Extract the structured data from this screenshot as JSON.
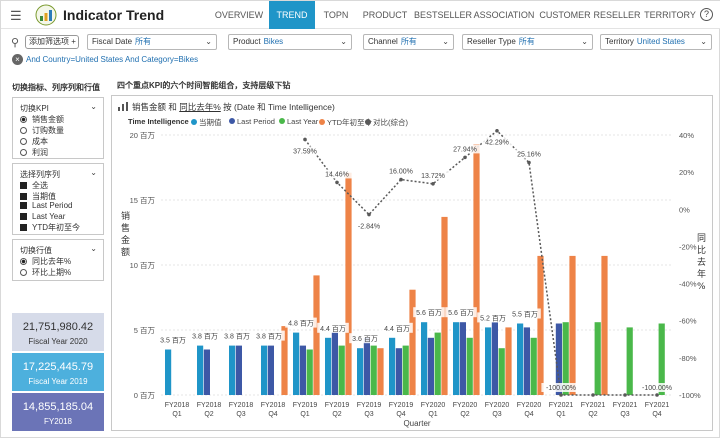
{
  "app": {
    "title": "Indicator Trend",
    "menu_icon": "hamburger-icon",
    "logo_icon": "sales-logo-icon",
    "help_icon": "help-icon",
    "help_glyph": "?",
    "tabs": [
      {
        "label": "OVERVIEW",
        "active": false
      },
      {
        "label": "TREND",
        "active": true
      },
      {
        "label": "TOPN",
        "active": false
      },
      {
        "label": "PRODUCT",
        "active": false
      },
      {
        "label": "BESTSELLER",
        "active": false
      },
      {
        "label": "ASSOCIATION",
        "active": false
      },
      {
        "label": "CUSTOMER",
        "active": false
      },
      {
        "label": "RESELLER",
        "active": false
      },
      {
        "label": "TERRITORY",
        "active": false
      }
    ]
  },
  "filters": {
    "add_filter_label": "添加筛选项 +",
    "slicers": [
      {
        "label": "Fiscal Date",
        "value": "所有"
      },
      {
        "label": "Product",
        "value": "Bikes"
      },
      {
        "label": "Channel",
        "value": "所有"
      },
      {
        "label": "Reseller Type",
        "value": "所有"
      },
      {
        "label": "Territory",
        "value": "United States"
      }
    ],
    "breadcrumb": "And Country=United States And Category=Bikes"
  },
  "left": {
    "heading": "切换指标、列序列和行值",
    "kpi_panel": {
      "title": "切换KPI",
      "options": [
        {
          "label": "销售金额",
          "selected": true
        },
        {
          "label": "订购数量",
          "selected": false
        },
        {
          "label": "成本",
          "selected": false
        },
        {
          "label": "利润",
          "selected": false
        }
      ]
    },
    "series_panel": {
      "title": "选择列序列",
      "options": [
        "全选",
        "当期值",
        "Last Period",
        "Last Year",
        "YTD年初至今"
      ]
    },
    "row_panel": {
      "title": "切换行值",
      "options": [
        {
          "label": "同比去年%",
          "selected": true
        },
        {
          "label": "环比上期%",
          "selected": false
        }
      ]
    },
    "cards": [
      {
        "value": "21,751,980.42",
        "caption": "Fiscal Year 2020",
        "bg": "#d6dbe9",
        "fg": "#333333"
      },
      {
        "value": "17,225,445.79",
        "caption": "Fiscal Year 2019",
        "bg": "#4db0dd",
        "fg": "#ffffff"
      },
      {
        "value": "14,855,185.04",
        "caption": "FY2018",
        "bg": "#6b74b7",
        "fg": "#ffffff"
      }
    ]
  },
  "chart": {
    "heading": "四个重点KPI的六个时间智能组合，支持层级下钻",
    "title_prefix": "销售金额 和 ",
    "title_link": "同比去年%",
    "title_suffix": " 按 (Date 和 Time Intelligence)",
    "legend_title": "Time Intelligence",
    "legend": [
      {
        "name": "当期值",
        "color": "#1f95c8"
      },
      {
        "name": "Last Period",
        "color": "#3d58a6"
      },
      {
        "name": "Last Year",
        "color": "#4ab84a"
      },
      {
        "name": "YTD年初至今",
        "color": "#ee8347"
      },
      {
        "name": "对比(综合)",
        "color": "#595959"
      }
    ]
  },
  "chart_data": {
    "type": "bar",
    "xlabel": "Quarter",
    "ylabel": "销售金额",
    "y2label": "同比去年%",
    "ylim": [
      0,
      20
    ],
    "y_ticks": [
      "0 百万",
      "5 百万",
      "10 百万",
      "15 百万",
      "20 百万"
    ],
    "y2lim": [
      -100,
      40
    ],
    "y2_ticks": [
      "-100%",
      "-80%",
      "-60%",
      "-40%",
      "-20%",
      "0%",
      "20%",
      "40%"
    ],
    "categories": [
      "FY2018 Q1",
      "FY2018 Q2",
      "FY2018 Q3",
      "FY2018 Q4",
      "FY2019 Q1",
      "FY2019 Q2",
      "FY2019 Q3",
      "FY2019 Q4",
      "FY2020 Q1",
      "FY2020 Q2",
      "FY2020 Q3",
      "FY2020 Q4",
      "FY2021 Q1",
      "FY2021 Q2",
      "FY2021 Q3",
      "FY2021 Q4"
    ],
    "series": [
      {
        "name": "当期值",
        "color": "#1f95c8",
        "values": [
          3.5,
          3.8,
          3.8,
          3.8,
          4.8,
          4.4,
          3.6,
          4.4,
          5.6,
          5.6,
          5.2,
          5.5,
          0,
          0,
          0,
          0
        ]
      },
      {
        "name": "Last Period",
        "color": "#3d58a6",
        "values": [
          0,
          3.5,
          3.8,
          3.8,
          3.8,
          4.8,
          4.4,
          3.6,
          4.4,
          5.6,
          5.6,
          5.2,
          5.5,
          0,
          0,
          0
        ]
      },
      {
        "name": "Last Year",
        "color": "#4ab84a",
        "values": [
          0,
          0,
          0,
          0,
          3.5,
          3.8,
          3.8,
          3.8,
          4.8,
          4.4,
          3.6,
          4.4,
          5.6,
          5.6,
          5.2,
          5.5
        ]
      },
      {
        "name": "YTD年初至今",
        "color": "#ee8347",
        "values": [
          0,
          0,
          0,
          5.3,
          9.2,
          17.1,
          3.6,
          8.1,
          13.7,
          19.3,
          5.2,
          10.7,
          10.7,
          10.7,
          0,
          0
        ]
      }
    ],
    "bar_labels": [
      "3.5 百万",
      "3.8 百万",
      "3.8 百万",
      "3.8 百万",
      "4.8 百万",
      "4.4 百万",
      "3.6 百万",
      "4.4 百万",
      "5.6 百万",
      "5.6 百万",
      "5.2 百万",
      "5.5 百万",
      "",
      "",
      "",
      ""
    ],
    "line": {
      "name": "对比(综合)",
      "color": "#595959",
      "values": [
        null,
        null,
        null,
        null,
        37.59,
        14.46,
        -2.84,
        16.0,
        13.72,
        27.94,
        42.29,
        25.16,
        -100.0,
        -100.0,
        -100.0,
        -100.0
      ],
      "labels": [
        "",
        "",
        "",
        "",
        "37.59%",
        "14.46%",
        "-2.84%",
        "16.00%",
        "13.72%",
        "27.94%",
        "42.29%",
        "25.16%",
        "-100.00%",
        "",
        "",
        "-100.00%"
      ]
    }
  }
}
